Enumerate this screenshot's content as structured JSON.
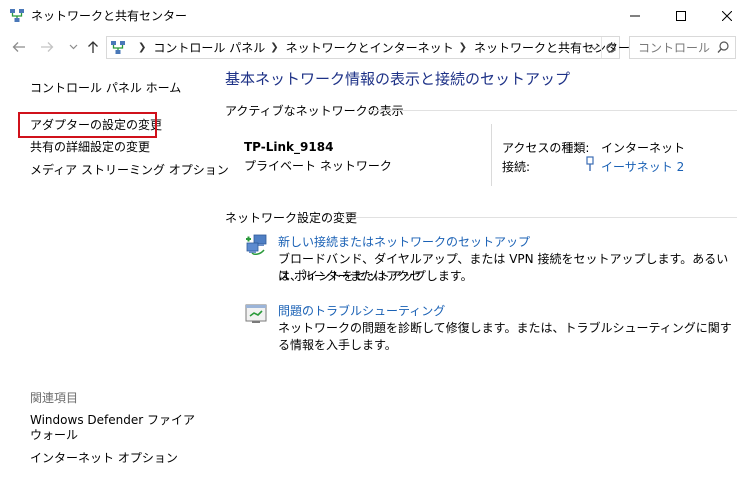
{
  "window": {
    "title": "ネットワークと共有センター",
    "controls": [
      "minimize",
      "maximize",
      "close"
    ]
  },
  "navigation": {
    "breadcrumbs": [
      "コントロール パネル",
      "ネットワークとインターネット",
      "ネットワークと共有センター"
    ],
    "search_placeholder": "コントロール ..."
  },
  "sidebar": {
    "home": "コントロール パネル ホーム",
    "items": [
      "アダプターの設定の変更",
      "共有の詳細設定の変更",
      "メディア ストリーミング オプション"
    ],
    "highlighted_item": "アダプターの設定の変更",
    "highlight_color": "#d0111b",
    "related_heading": "関連項目",
    "related": [
      "Windows Defender ファイアウォール",
      "インターネット オプション"
    ]
  },
  "main": {
    "title": "基本ネットワーク情報の表示と接続のセットアップ",
    "active_networks_label": "アクティブなネットワークの表示",
    "network": {
      "name": "TP-Link_9184",
      "type": "プライベート ネットワーク",
      "access_type_label": "アクセスの種類:",
      "access_type_value": "インターネット",
      "connection_label": "接続:",
      "connection_value": "イーサネット 2"
    },
    "settings_label": "ネットワーク設定の変更",
    "tasks": [
      {
        "link": "新しい接続またはネットワークのセットアップ",
        "description_line1": "ブロードバンド、ダイヤルアップ、または VPN 接続をセットアップします。あるいは、ルーターまたはアクセ",
        "description_line2": "ス ポイントをセットアップします。",
        "icon": "network-setup-icon"
      },
      {
        "link": "問題のトラブルシューティング",
        "description_line1": "ネットワークの問題を診断して修復します。または、トラブルシューティングに関する情報を入手します。",
        "icon": "troubleshoot-icon"
      }
    ]
  },
  "colors": {
    "title_text": "#1e3287",
    "link": "#1a61b5"
  }
}
